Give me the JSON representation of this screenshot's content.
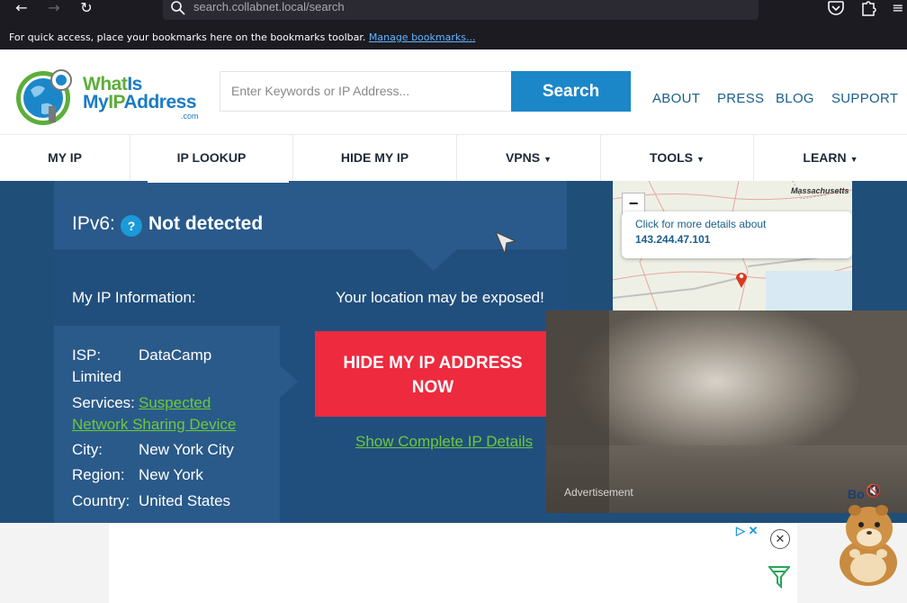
{
  "browser": {
    "url": "search.collabnet.local/search",
    "bookmarks_text": "For quick access, place your bookmarks here on the bookmarks toolbar.",
    "bookmarks_link": "Manage bookmarks..."
  },
  "header": {
    "logo_line1_a": "What",
    "logo_line1_b": "Is",
    "logo_line2_a": "My",
    "logo_line2_b": "IP",
    "logo_line2_c": "Address",
    "logo_com": ".com",
    "search_placeholder": "Enter Keywords or IP Address...",
    "search_button": "Search",
    "links": [
      "ABOUT",
      "PRESS",
      "BLOG",
      "SUPPORT"
    ]
  },
  "nav": {
    "items": [
      {
        "label": "MY IP",
        "caret": ""
      },
      {
        "label": "IP LOOKUP",
        "caret": ""
      },
      {
        "label": "HIDE MY IP",
        "caret": ""
      },
      {
        "label": "VPNS",
        "caret": "▼"
      },
      {
        "label": "TOOLS",
        "caret": "▼"
      },
      {
        "label": "LEARN",
        "caret": "▼"
      }
    ]
  },
  "main": {
    "ipv6_label": "IPv6:",
    "ipv6_help": "?",
    "ipv6_value": "Not detected",
    "info_title": "My IP Information:",
    "exposed_text": "Your location may be exposed!",
    "info": {
      "isp_key": "ISP:",
      "isp_value": "DataCamp",
      "isp_value2": "Limited",
      "services_key": "Services:",
      "services_value": "Suspected",
      "services_value2": "Network Sharing Device",
      "city_key": "City:",
      "city_value": "New York City",
      "region_key": "Region:",
      "region_value": "New York",
      "country_key": "Country:",
      "country_value": "United States"
    },
    "hide_button_line1": "HIDE MY IP ADDRESS",
    "hide_button_line2": "NOW",
    "show_details": "Show Complete IP Details"
  },
  "map": {
    "zoom_out": "−",
    "region_label": "Massachusetts",
    "popup_text": "Click for more details about",
    "popup_ip": "143.244.47.101"
  },
  "video_ad": {
    "label": "Advertisement",
    "brand": "Bo",
    "mute": "🔇"
  },
  "bottom_ad": {
    "adchoices": "▷ ✕",
    "close": "✕"
  },
  "colors": {
    "brand_blue": "#1b87c9",
    "main_bg": "#1f4e79",
    "hide_red": "#ee2a3e",
    "link_green": "#6ec83c"
  }
}
